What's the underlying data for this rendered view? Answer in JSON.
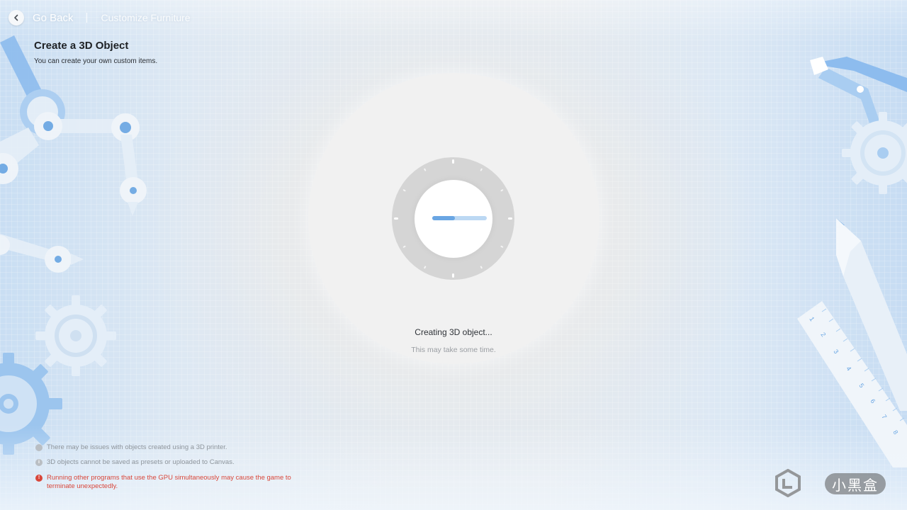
{
  "header": {
    "back_label": "Go Back",
    "breadcrumb": "Customize Furniture"
  },
  "page": {
    "title": "Create a 3D Object",
    "subtitle": "You can create your own custom items."
  },
  "loader": {
    "status": "Creating 3D object...",
    "hint": "This may take some time.",
    "progress": 0.42
  },
  "notices": [
    {
      "type": "info",
      "icon": "info-icon",
      "text": "There may be issues with objects created using a 3D printer."
    },
    {
      "type": "info",
      "icon": "info-icon",
      "text": "3D objects cannot be saved as presets or uploaded to Canvas."
    },
    {
      "type": "warning",
      "icon": "alert-icon",
      "text": "Running other programs that use the GPU simultaneously may cause the game to terminate unexpectedly."
    }
  ],
  "watermark": {
    "text": "小黑盒"
  },
  "colors": {
    "accent": "#6aa6e3",
    "accent_light": "#bcd8f3",
    "warning": "#d8463a",
    "deco_blue": "#8dbcee",
    "deco_white": "#e4eef8"
  }
}
